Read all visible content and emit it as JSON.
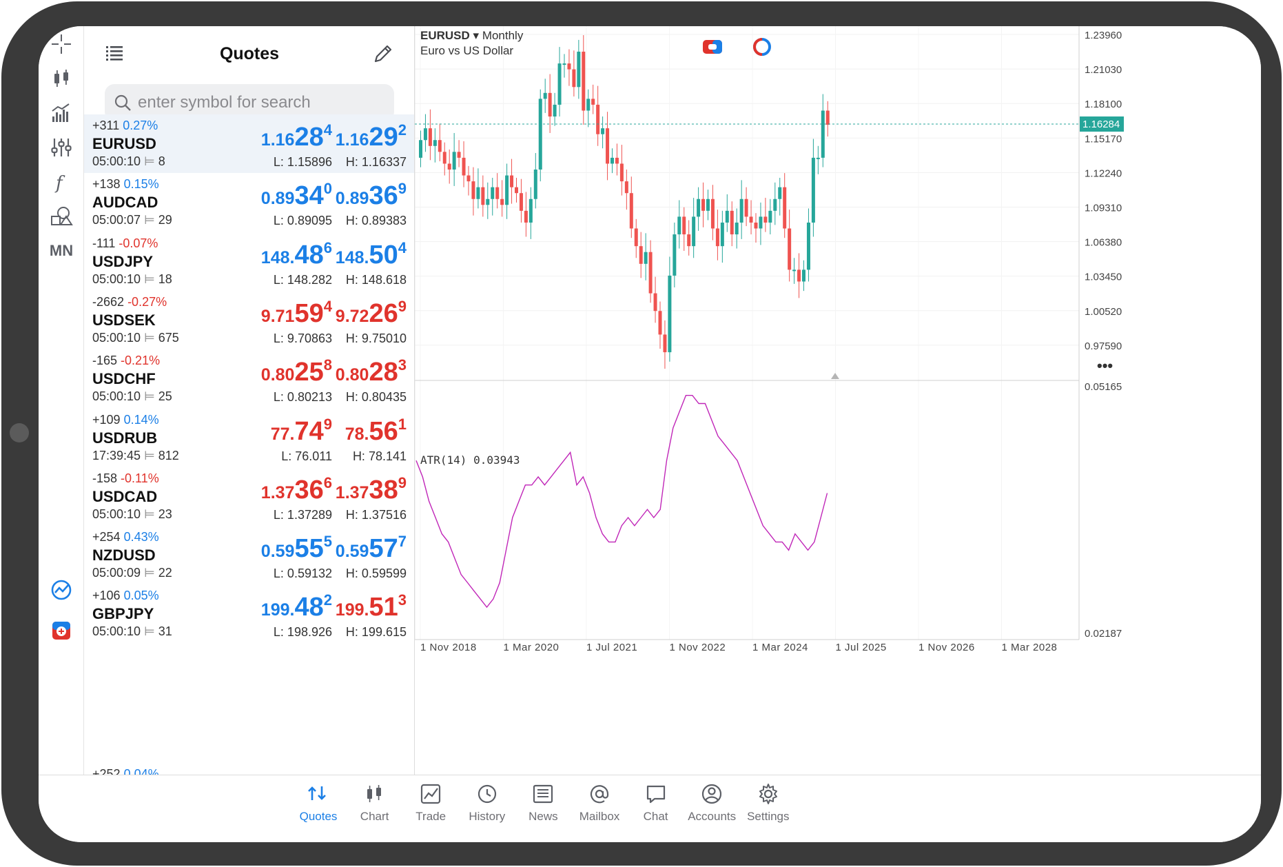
{
  "header": {
    "title": "Quotes",
    "search_placeholder": "enter symbol for search"
  },
  "sidebar_tools": [
    "crosshair-icon",
    "candlestick-icon",
    "indicators-icon",
    "settings-sliders-icon",
    "function-icon",
    "objects-icon"
  ],
  "timeframe_label": "MN",
  "quotes": [
    {
      "symbol": "EURUSD",
      "change": "+311",
      "pct": "0.27%",
      "dir": "up",
      "time": "05:00:10",
      "spread": "8",
      "bid_main": "1.16",
      "bid_big": "28",
      "bid_sup": "4",
      "ask_main": "1.16",
      "ask_big": "29",
      "ask_sup": "2",
      "low": "L: 1.15896",
      "high": "H: 1.16337",
      "bid_color": "up",
      "ask_color": "up"
    },
    {
      "symbol": "AUDCAD",
      "change": "+138",
      "pct": "0.15%",
      "dir": "up",
      "time": "05:00:07",
      "spread": "29",
      "bid_main": "0.89",
      "bid_big": "34",
      "bid_sup": "0",
      "ask_main": "0.89",
      "ask_big": "36",
      "ask_sup": "9",
      "low": "L: 0.89095",
      "high": "H: 0.89383",
      "bid_color": "up",
      "ask_color": "up"
    },
    {
      "symbol": "USDJPY",
      "change": "-111",
      "pct": "-0.07%",
      "dir": "dn",
      "time": "05:00:10",
      "spread": "18",
      "bid_main": "148.",
      "bid_big": "48",
      "bid_sup": "6",
      "ask_main": "148.",
      "ask_big": "50",
      "ask_sup": "4",
      "low": "L: 148.282",
      "high": "H: 148.618",
      "bid_color": "up",
      "ask_color": "up"
    },
    {
      "symbol": "USDSEK",
      "change": "-2662",
      "pct": "-0.27%",
      "dir": "dn",
      "time": "05:00:10",
      "spread": "675",
      "bid_main": "9.71",
      "bid_big": "59",
      "bid_sup": "4",
      "ask_main": "9.72",
      "ask_big": "26",
      "ask_sup": "9",
      "low": "L: 9.70863",
      "high": "H: 9.75010",
      "bid_color": "dn",
      "ask_color": "dn"
    },
    {
      "symbol": "USDCHF",
      "change": "-165",
      "pct": "-0.21%",
      "dir": "dn",
      "time": "05:00:10",
      "spread": "25",
      "bid_main": "0.80",
      "bid_big": "25",
      "bid_sup": "8",
      "ask_main": "0.80",
      "ask_big": "28",
      "ask_sup": "3",
      "low": "L: 0.80213",
      "high": "H: 0.80435",
      "bid_color": "dn",
      "ask_color": "dn"
    },
    {
      "symbol": "USDRUB",
      "change": "+109",
      "pct": "0.14%",
      "dir": "up",
      "time": "17:39:45",
      "spread": "812",
      "bid_main": "77.",
      "bid_big": "74",
      "bid_sup": "9",
      "ask_main": "78.",
      "ask_big": "56",
      "ask_sup": "1",
      "low": "L: 76.011",
      "high": "H: 78.141",
      "bid_color": "dn",
      "ask_color": "dn"
    },
    {
      "symbol": "USDCAD",
      "change": "-158",
      "pct": "-0.11%",
      "dir": "dn",
      "time": "05:00:10",
      "spread": "23",
      "bid_main": "1.37",
      "bid_big": "36",
      "bid_sup": "6",
      "ask_main": "1.37",
      "ask_big": "38",
      "ask_sup": "9",
      "low": "L: 1.37289",
      "high": "H: 1.37516",
      "bid_color": "dn",
      "ask_color": "dn"
    },
    {
      "symbol": "NZDUSD",
      "change": "+254",
      "pct": "0.43%",
      "dir": "up",
      "time": "05:00:09",
      "spread": "22",
      "bid_main": "0.59",
      "bid_big": "55",
      "bid_sup": "5",
      "ask_main": "0.59",
      "ask_big": "57",
      "ask_sup": "7",
      "low": "L: 0.59132",
      "high": "H: 0.59599",
      "bid_color": "up",
      "ask_color": "up"
    },
    {
      "symbol": "GBPJPY",
      "change": "+106",
      "pct": "0.05%",
      "dir": "up",
      "time": "05:00:10",
      "spread": "31",
      "bid_main": "199.",
      "bid_big": "48",
      "bid_sup": "2",
      "ask_main": "199.",
      "ask_big": "51",
      "ask_sup": "3",
      "low": "L: 198.926",
      "high": "H: 199.615",
      "bid_color": "up",
      "ask_color": "dn"
    }
  ],
  "chart": {
    "symbol": "EURUSD",
    "timeframe": "Monthly",
    "description": "Euro vs US Dollar",
    "current_price": "1.16284",
    "price_axis": [
      "1.23960",
      "1.21030",
      "1.18100",
      "1.15170",
      "1.12240",
      "1.09310",
      "1.06380",
      "1.03450",
      "1.00520",
      "0.97590"
    ],
    "indicator_label": "ATR(14) 0.03943",
    "indicator_axis": [
      "0.05165",
      "0.02187"
    ],
    "time_axis": [
      "1 Nov 2018",
      "1 Mar 2020",
      "1 Jul 2021",
      "1 Nov 2022",
      "1 Mar 2024",
      "1 Jul 2025",
      "1 Nov 2026",
      "1 Mar 2028"
    ],
    "bull_color": "#26a69a",
    "bear_color": "#ef5350",
    "atr_color": "#c026b8"
  },
  "chart_data": {
    "type": "candlestick",
    "title": "EURUSD Monthly",
    "xlabel": "",
    "ylabel": "",
    "ylim": [
      0.95,
      1.25
    ],
    "closes_approx": [
      1.15,
      1.16,
      1.145,
      1.15,
      1.14,
      1.13,
      1.125,
      1.14,
      1.135,
      1.12,
      1.115,
      1.1,
      1.11,
      1.095,
      1.1,
      1.11,
      1.1,
      1.095,
      1.12,
      1.11,
      1.105,
      1.09,
      1.08,
      1.1,
      1.125,
      1.185,
      1.19,
      1.17,
      1.18,
      1.215,
      1.215,
      1.21,
      1.195,
      1.225,
      1.175,
      1.185,
      1.18,
      1.155,
      1.16,
      1.13,
      1.135,
      1.13,
      1.115,
      1.105,
      1.075,
      1.06,
      1.045,
      1.055,
      1.02,
      1.005,
      0.985,
      0.97,
      1.035,
      1.07,
      1.085,
      1.07,
      1.06,
      1.085,
      1.1,
      1.09,
      1.1,
      1.075,
      1.06,
      1.08,
      1.09,
      1.07,
      1.08,
      1.1,
      1.085,
      1.08,
      1.075,
      1.085,
      1.08,
      1.09,
      1.1,
      1.11,
      1.075,
      1.04,
      1.04,
      1.03,
      1.04,
      1.08,
      1.135,
      1.135,
      1.175,
      1.163
    ],
    "atr_approx": [
      0.043,
      0.041,
      0.038,
      0.036,
      0.034,
      0.033,
      0.031,
      0.029,
      0.028,
      0.027,
      0.026,
      0.025,
      0.026,
      0.028,
      0.032,
      0.036,
      0.038,
      0.04,
      0.04,
      0.041,
      0.04,
      0.041,
      0.042,
      0.043,
      0.044,
      0.04,
      0.041,
      0.039,
      0.036,
      0.034,
      0.033,
      0.033,
      0.035,
      0.036,
      0.035,
      0.036,
      0.037,
      0.036,
      0.037,
      0.043,
      0.047,
      0.049,
      0.051,
      0.051,
      0.05,
      0.05,
      0.048,
      0.046,
      0.045,
      0.044,
      0.043,
      0.041,
      0.039,
      0.037,
      0.035,
      0.034,
      0.033,
      0.033,
      0.032,
      0.034,
      0.033,
      0.032,
      0.033,
      0.036,
      0.039
    ]
  },
  "tabs": [
    {
      "id": "quotes",
      "label": "Quotes",
      "active": true
    },
    {
      "id": "chart",
      "label": "Chart",
      "active": false
    },
    {
      "id": "trade",
      "label": "Trade",
      "active": false
    },
    {
      "id": "history",
      "label": "History",
      "active": false
    },
    {
      "id": "news",
      "label": "News",
      "active": false
    },
    {
      "id": "mailbox",
      "label": "Mailbox",
      "active": false
    },
    {
      "id": "chat",
      "label": "Chat",
      "active": false
    },
    {
      "id": "accounts",
      "label": "Accounts",
      "active": false
    },
    {
      "id": "settings",
      "label": "Settings",
      "active": false
    }
  ],
  "colors": {
    "accent": "#1b7fe6",
    "down": "#e0332c",
    "selected_row": "#eef3f9"
  }
}
